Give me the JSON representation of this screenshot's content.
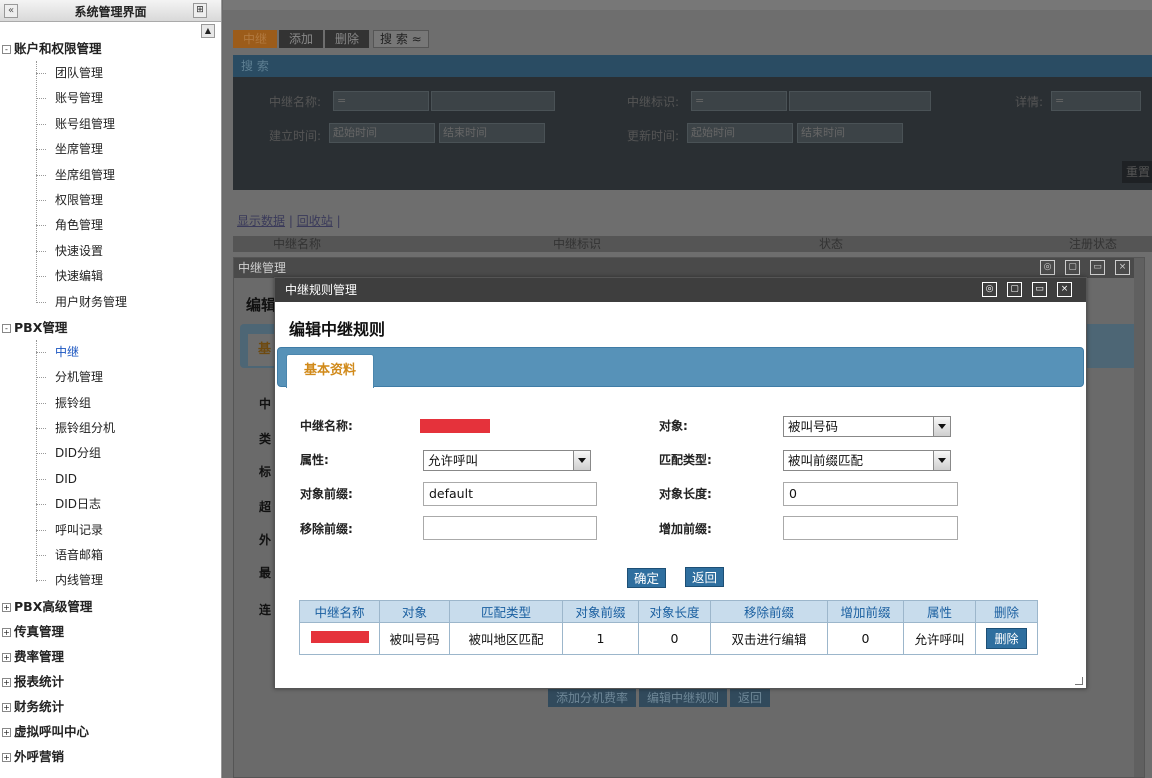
{
  "sidebar": {
    "title": "系统管理界面",
    "collapse_icon": "«",
    "pin_icon": "⊞",
    "groups": [
      {
        "label": "账户和权限管理",
        "items": [
          "团队管理",
          "账号管理",
          "账号组管理",
          "坐席管理",
          "坐席组管理",
          "权限管理",
          "角色管理",
          "快速设置",
          "快速编辑",
          "用户财务管理"
        ]
      },
      {
        "label": "PBX管理",
        "items": [
          "中继",
          "分机管理",
          "振铃组",
          "振铃组分机",
          "DID分组",
          "DID",
          "DID日志",
          "呼叫记录",
          "语音邮箱",
          "内线管理"
        ]
      },
      {
        "label": "PBX高级管理"
      },
      {
        "label": "传真管理"
      },
      {
        "label": "费率管理"
      },
      {
        "label": "报表统计"
      },
      {
        "label": "财务统计"
      },
      {
        "label": "虚拟呼叫中心"
      },
      {
        "label": "外呼营销"
      }
    ],
    "active_item": "中继"
  },
  "main": {
    "toolbar": {
      "trunk": "中继",
      "add": "添加",
      "delete": "删除",
      "search": "搜 索 ≈"
    },
    "search_panel": {
      "header": "搜 索",
      "trunk_name_label": "中继名称:",
      "trunk_id_label": "中继标识:",
      "detail_label": "详情:",
      "created_label": "建立时间:",
      "updated_label": "更新时间:",
      "start_time": "起始时间",
      "end_time": "结束时间",
      "eq": "=",
      "reset": "重置"
    },
    "links": {
      "show_data": "显示数据",
      "sep": "|",
      "recycle": "回收站",
      "sep2": "|"
    },
    "grid_columns": [
      "中继名称",
      "中继标识",
      "状态",
      "注册状态"
    ]
  },
  "window_trunk": {
    "title": "中继管理",
    "heading": "编辑",
    "tab": "基",
    "labels": [
      "中",
      "类",
      "标",
      "超",
      "外",
      "最",
      "连"
    ],
    "buttons": [
      "添加分机费率",
      "编辑中继规则",
      "返回"
    ]
  },
  "modal": {
    "title": "中继规则管理",
    "heading": "编辑中继规则",
    "tab": "基本资料",
    "fields": {
      "trunk_name_label": "中继名称:",
      "object_label": "对象:",
      "object_value": "被叫号码",
      "attribute_label": "属性:",
      "attribute_value": "允许呼叫",
      "match_type_label": "匹配类型:",
      "match_type_value": "被叫前缀匹配",
      "object_prefix_label": "对象前缀:",
      "object_prefix_value": "default",
      "object_length_label": "对象长度:",
      "object_length_value": "0",
      "remove_prefix_label": "移除前缀:",
      "remove_prefix_value": "",
      "add_prefix_label": "增加前缀:",
      "add_prefix_value": ""
    },
    "buttons": {
      "ok": "确定",
      "back": "返回"
    },
    "table": {
      "headers": [
        "中继名称",
        "对象",
        "匹配类型",
        "对象前缀",
        "对象长度",
        "移除前缀",
        "增加前缀",
        "属性",
        "删除"
      ],
      "rows": [
        {
          "object": "被叫号码",
          "match_type": "被叫地区匹配",
          "prefix": "1",
          "length": "0",
          "remove_prefix": "双击进行编辑",
          "add_prefix": "0",
          "attribute": "允许呼叫",
          "delete": "删除"
        }
      ]
    }
  }
}
